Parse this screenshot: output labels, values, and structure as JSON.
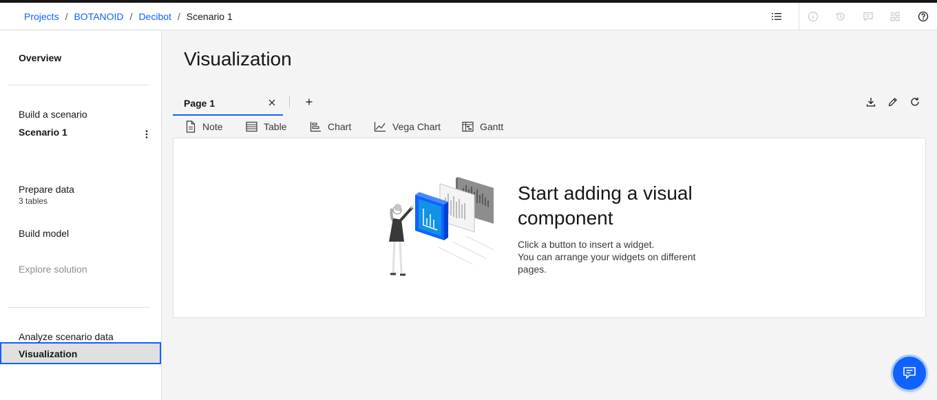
{
  "breadcrumb": {
    "items": [
      "Projects",
      "BOTANOID",
      "Decibot"
    ],
    "separator": "/",
    "current": "Scenario 1"
  },
  "header_icons": [
    "list-icon",
    "info-icon",
    "history-icon",
    "comment-icon",
    "apps-icon",
    "help-icon"
  ],
  "sidebar": {
    "overview": "Overview",
    "build_scenario": "Build a scenario",
    "scenario_name": "Scenario 1",
    "prepare_data": "Prepare data",
    "prepare_data_sub": "3 tables",
    "build_model": "Build model",
    "explore_solution": "Explore solution",
    "analyze_scenario_data": "Analyze scenario data",
    "visualization": "Visualization"
  },
  "main": {
    "title": "Visualization",
    "tabs": [
      {
        "label": "Page 1",
        "active": true
      }
    ],
    "widgets": [
      "Note",
      "Table",
      "Chart",
      "Vega Chart",
      "Gantt"
    ],
    "empty_state": {
      "title": "Start adding a visual component",
      "body_lines": [
        "Click a button to insert a widget.",
        "You can arrange your widgets on different",
        "pages."
      ]
    }
  },
  "colors": {
    "accent": "#0f62fe",
    "background": "#f4f4f4",
    "text": "#161616"
  }
}
